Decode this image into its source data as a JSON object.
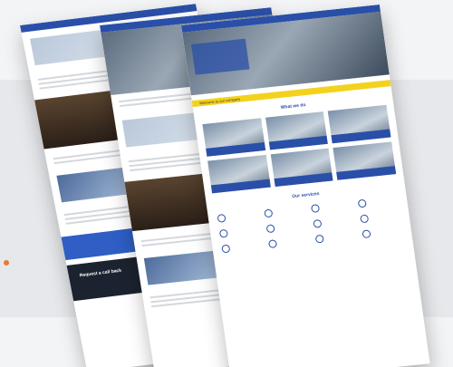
{
  "p1": {
    "cta": "Request a call back"
  },
  "p3": {
    "banner": "Welcome to our company",
    "section_title": "What we do",
    "cards": [
      "",
      "",
      "",
      "",
      "",
      ""
    ],
    "services_title": "Our services",
    "services": [
      "",
      "",
      "",
      "",
      "",
      "",
      "",
      "",
      "",
      "",
      "",
      ""
    ]
  },
  "colors": {
    "brand_blue": "#2a4fa8",
    "accent_yellow": "#f3d21e",
    "dark_footer": "#1b2330",
    "accent_orange": "#e8783a"
  }
}
